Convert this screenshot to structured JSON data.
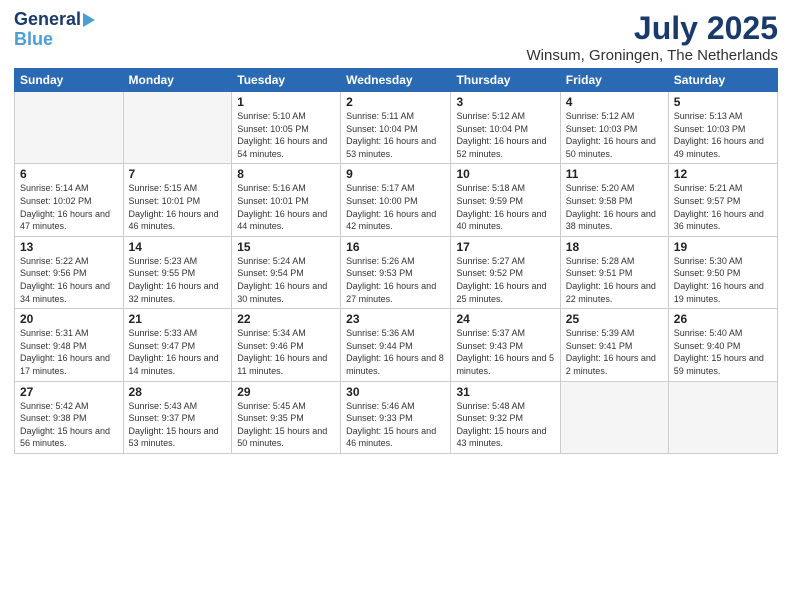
{
  "logo": {
    "line1": "General",
    "line2": "Blue"
  },
  "header": {
    "month": "July 2025",
    "location": "Winsum, Groningen, The Netherlands"
  },
  "weekdays": [
    "Sunday",
    "Monday",
    "Tuesday",
    "Wednesday",
    "Thursday",
    "Friday",
    "Saturday"
  ],
  "weeks": [
    [
      {
        "day": "",
        "sunrise": "",
        "sunset": "",
        "daylight": ""
      },
      {
        "day": "",
        "sunrise": "",
        "sunset": "",
        "daylight": ""
      },
      {
        "day": "1",
        "sunrise": "Sunrise: 5:10 AM",
        "sunset": "Sunset: 10:05 PM",
        "daylight": "Daylight: 16 hours and 54 minutes."
      },
      {
        "day": "2",
        "sunrise": "Sunrise: 5:11 AM",
        "sunset": "Sunset: 10:04 PM",
        "daylight": "Daylight: 16 hours and 53 minutes."
      },
      {
        "day": "3",
        "sunrise": "Sunrise: 5:12 AM",
        "sunset": "Sunset: 10:04 PM",
        "daylight": "Daylight: 16 hours and 52 minutes."
      },
      {
        "day": "4",
        "sunrise": "Sunrise: 5:12 AM",
        "sunset": "Sunset: 10:03 PM",
        "daylight": "Daylight: 16 hours and 50 minutes."
      },
      {
        "day": "5",
        "sunrise": "Sunrise: 5:13 AM",
        "sunset": "Sunset: 10:03 PM",
        "daylight": "Daylight: 16 hours and 49 minutes."
      }
    ],
    [
      {
        "day": "6",
        "sunrise": "Sunrise: 5:14 AM",
        "sunset": "Sunset: 10:02 PM",
        "daylight": "Daylight: 16 hours and 47 minutes."
      },
      {
        "day": "7",
        "sunrise": "Sunrise: 5:15 AM",
        "sunset": "Sunset: 10:01 PM",
        "daylight": "Daylight: 16 hours and 46 minutes."
      },
      {
        "day": "8",
        "sunrise": "Sunrise: 5:16 AM",
        "sunset": "Sunset: 10:01 PM",
        "daylight": "Daylight: 16 hours and 44 minutes."
      },
      {
        "day": "9",
        "sunrise": "Sunrise: 5:17 AM",
        "sunset": "Sunset: 10:00 PM",
        "daylight": "Daylight: 16 hours and 42 minutes."
      },
      {
        "day": "10",
        "sunrise": "Sunrise: 5:18 AM",
        "sunset": "Sunset: 9:59 PM",
        "daylight": "Daylight: 16 hours and 40 minutes."
      },
      {
        "day": "11",
        "sunrise": "Sunrise: 5:20 AM",
        "sunset": "Sunset: 9:58 PM",
        "daylight": "Daylight: 16 hours and 38 minutes."
      },
      {
        "day": "12",
        "sunrise": "Sunrise: 5:21 AM",
        "sunset": "Sunset: 9:57 PM",
        "daylight": "Daylight: 16 hours and 36 minutes."
      }
    ],
    [
      {
        "day": "13",
        "sunrise": "Sunrise: 5:22 AM",
        "sunset": "Sunset: 9:56 PM",
        "daylight": "Daylight: 16 hours and 34 minutes."
      },
      {
        "day": "14",
        "sunrise": "Sunrise: 5:23 AM",
        "sunset": "Sunset: 9:55 PM",
        "daylight": "Daylight: 16 hours and 32 minutes."
      },
      {
        "day": "15",
        "sunrise": "Sunrise: 5:24 AM",
        "sunset": "Sunset: 9:54 PM",
        "daylight": "Daylight: 16 hours and 30 minutes."
      },
      {
        "day": "16",
        "sunrise": "Sunrise: 5:26 AM",
        "sunset": "Sunset: 9:53 PM",
        "daylight": "Daylight: 16 hours and 27 minutes."
      },
      {
        "day": "17",
        "sunrise": "Sunrise: 5:27 AM",
        "sunset": "Sunset: 9:52 PM",
        "daylight": "Daylight: 16 hours and 25 minutes."
      },
      {
        "day": "18",
        "sunrise": "Sunrise: 5:28 AM",
        "sunset": "Sunset: 9:51 PM",
        "daylight": "Daylight: 16 hours and 22 minutes."
      },
      {
        "day": "19",
        "sunrise": "Sunrise: 5:30 AM",
        "sunset": "Sunset: 9:50 PM",
        "daylight": "Daylight: 16 hours and 19 minutes."
      }
    ],
    [
      {
        "day": "20",
        "sunrise": "Sunrise: 5:31 AM",
        "sunset": "Sunset: 9:48 PM",
        "daylight": "Daylight: 16 hours and 17 minutes."
      },
      {
        "day": "21",
        "sunrise": "Sunrise: 5:33 AM",
        "sunset": "Sunset: 9:47 PM",
        "daylight": "Daylight: 16 hours and 14 minutes."
      },
      {
        "day": "22",
        "sunrise": "Sunrise: 5:34 AM",
        "sunset": "Sunset: 9:46 PM",
        "daylight": "Daylight: 16 hours and 11 minutes."
      },
      {
        "day": "23",
        "sunrise": "Sunrise: 5:36 AM",
        "sunset": "Sunset: 9:44 PM",
        "daylight": "Daylight: 16 hours and 8 minutes."
      },
      {
        "day": "24",
        "sunrise": "Sunrise: 5:37 AM",
        "sunset": "Sunset: 9:43 PM",
        "daylight": "Daylight: 16 hours and 5 minutes."
      },
      {
        "day": "25",
        "sunrise": "Sunrise: 5:39 AM",
        "sunset": "Sunset: 9:41 PM",
        "daylight": "Daylight: 16 hours and 2 minutes."
      },
      {
        "day": "26",
        "sunrise": "Sunrise: 5:40 AM",
        "sunset": "Sunset: 9:40 PM",
        "daylight": "Daylight: 15 hours and 59 minutes."
      }
    ],
    [
      {
        "day": "27",
        "sunrise": "Sunrise: 5:42 AM",
        "sunset": "Sunset: 9:38 PM",
        "daylight": "Daylight: 15 hours and 56 minutes."
      },
      {
        "day": "28",
        "sunrise": "Sunrise: 5:43 AM",
        "sunset": "Sunset: 9:37 PM",
        "daylight": "Daylight: 15 hours and 53 minutes."
      },
      {
        "day": "29",
        "sunrise": "Sunrise: 5:45 AM",
        "sunset": "Sunset: 9:35 PM",
        "daylight": "Daylight: 15 hours and 50 minutes."
      },
      {
        "day": "30",
        "sunrise": "Sunrise: 5:46 AM",
        "sunset": "Sunset: 9:33 PM",
        "daylight": "Daylight: 15 hours and 46 minutes."
      },
      {
        "day": "31",
        "sunrise": "Sunrise: 5:48 AM",
        "sunset": "Sunset: 9:32 PM",
        "daylight": "Daylight: 15 hours and 43 minutes."
      },
      {
        "day": "",
        "sunrise": "",
        "sunset": "",
        "daylight": ""
      },
      {
        "day": "",
        "sunrise": "",
        "sunset": "",
        "daylight": ""
      }
    ]
  ]
}
